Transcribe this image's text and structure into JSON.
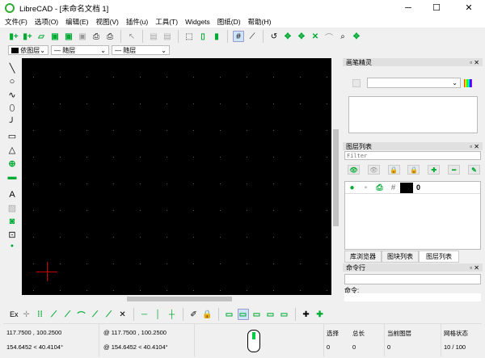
{
  "window": {
    "title": "LibreCAD - [未命名文档 1]",
    "minimize": "─",
    "maximize": "☐",
    "close": "✕"
  },
  "menu": [
    "文件(F)",
    "选项(O)",
    "编辑(E)",
    "视图(V)",
    "插件(u)",
    "工具(T)",
    "Widgets",
    "图纸(D)",
    "帮助(H)"
  ],
  "pen_toolbar": {
    "color": "依图层",
    "width": "— 随层",
    "type": "— 随层"
  },
  "pen_wizard": {
    "title": "画笔精灵"
  },
  "layer_list": {
    "title": "图层列表",
    "filter_placeholder": "Filter",
    "layers": [
      {
        "name": "0",
        "color": "#000000"
      }
    ]
  },
  "tabs": [
    "库浏览器",
    "图块列表",
    "图层列表"
  ],
  "active_tab": 2,
  "command_line": {
    "title": "命令行",
    "label": "命令:"
  },
  "bottom_toolbar": {
    "ex_label": "Ex"
  },
  "status": {
    "abs_coord": "117.7500 , 100.2500",
    "abs_polar": "154.6452 < 40.4104°",
    "rel_coord": "@  117.7500 , 100.2500",
    "rel_polar": "@  154.6452 < 40.4104°",
    "selected_label": "选择",
    "selected_value": "0",
    "total_label": "总长",
    "total_value": "0",
    "layer_label": "当前图层",
    "layer_value": "0",
    "grid_label": "网格状态",
    "grid_value": "10 / 100"
  },
  "colors": {
    "accent": "#00cc44",
    "canvas": "#000000",
    "crosshair": "#cc0000"
  }
}
